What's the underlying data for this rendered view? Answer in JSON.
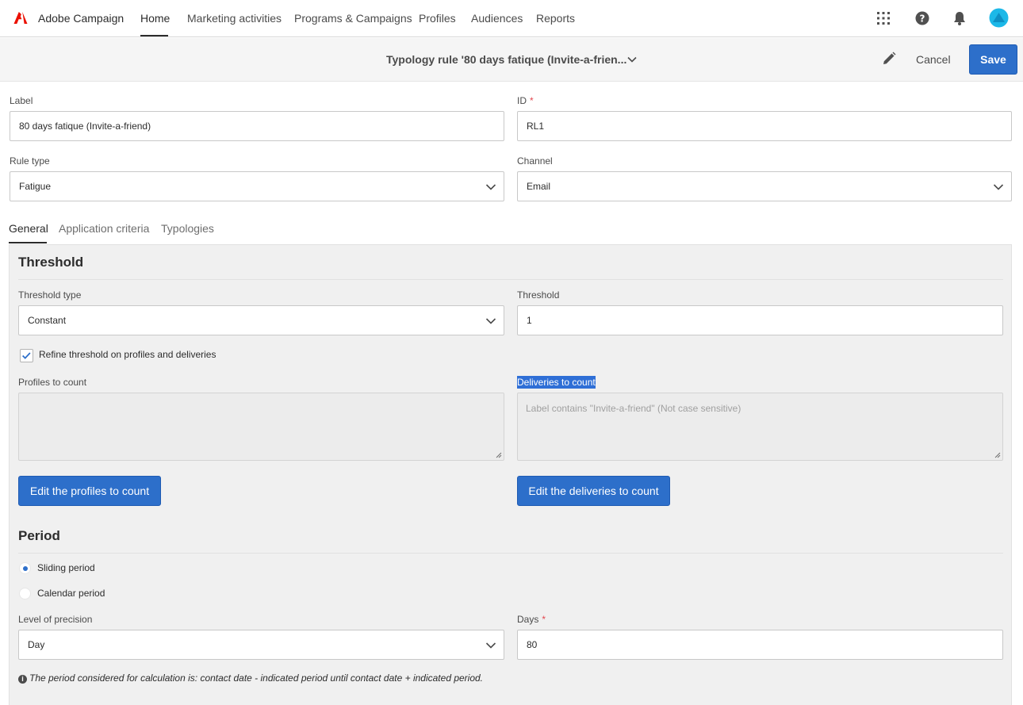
{
  "nav": {
    "app_name": "Adobe Campaign",
    "items": [
      {
        "label": "Home"
      },
      {
        "label": "Marketing activities"
      },
      {
        "label": "Programs & Campaigns"
      },
      {
        "label": "Profiles"
      },
      {
        "label": "Audiences"
      },
      {
        "label": "Reports"
      }
    ],
    "icons": [
      "apps-grid-icon",
      "help-icon",
      "bell-icon",
      "avatar"
    ]
  },
  "titlebar": {
    "title": "Typology rule '80 days fatique (Invite-a-frien...",
    "cancel_label": "Cancel",
    "save_label": "Save"
  },
  "form": {
    "label": {
      "label": "Label",
      "value": "80 days fatique (Invite-a-friend)"
    },
    "id": {
      "label": "ID",
      "required": "*",
      "value": "RL1"
    },
    "rule_type": {
      "label": "Rule type",
      "value": "Fatigue"
    },
    "channel": {
      "label": "Channel",
      "value": "Email"
    }
  },
  "tabs": [
    {
      "label": "General"
    },
    {
      "label": "Application criteria"
    },
    {
      "label": "Typologies"
    }
  ],
  "threshold": {
    "title": "Threshold",
    "type_label": "Threshold type",
    "type_value": "Constant",
    "threshold_label": "Threshold",
    "threshold_value": "1",
    "refine_label": "Refine threshold on profiles and deliveries",
    "refine_checked": true,
    "profiles_label": "Profiles to count",
    "profiles_value": "",
    "deliveries_label": "Deliveries to count",
    "deliveries_value": "Label contains \"Invite-a-friend\" (Not case sensitive)",
    "edit_profiles_label": "Edit the profiles to count",
    "edit_deliveries_label": "Edit the deliveries to count"
  },
  "period": {
    "title": "Period",
    "sliding_label": "Sliding period",
    "calendar_label": "Calendar period",
    "selected": "Sliding period",
    "precision_label": "Level of precision",
    "precision_value": "Day",
    "days_label": "Days",
    "days_required": "*",
    "days_value": "80",
    "info": "The period considered for calculation is: contact date - indicated period until contact date + indicated period."
  },
  "colors": {
    "accent": "#2d6fca",
    "adobe_red": "#eb1000",
    "avatar": "#1cb8e8"
  }
}
